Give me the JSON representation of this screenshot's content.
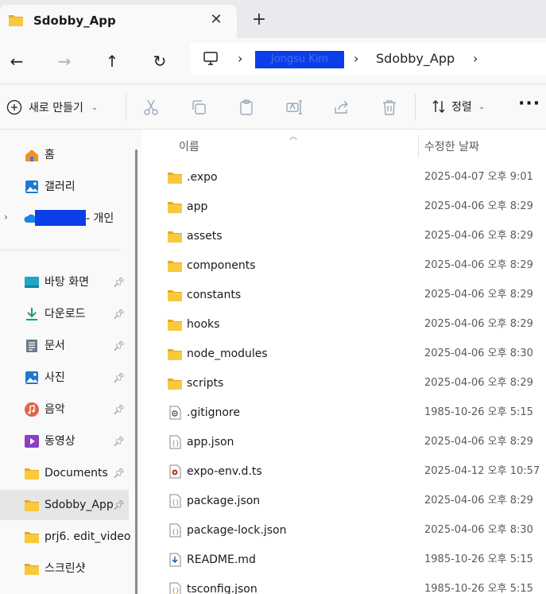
{
  "tab": {
    "title": "Sdobby_App",
    "close": "✕",
    "new": "+"
  },
  "nav": {
    "back": "←",
    "forward": "→",
    "up": "↑",
    "refresh": "↻",
    "breadcrumbs": [
      "Jongsu Kim",
      "Sdobby_App"
    ],
    "sep": "›"
  },
  "toolbar": {
    "new_label": "새로 만들기",
    "sort_label": "정렬",
    "more": "···"
  },
  "sidebar": {
    "items": [
      {
        "label": "홈",
        "icon": "home-icon"
      },
      {
        "label": "갤러리",
        "icon": "gallery-icon"
      },
      {
        "label": "- 개인",
        "icon": "onedrive-icon"
      },
      {
        "label": "바탕 화면",
        "icon": "desktop-icon"
      },
      {
        "label": "다운로드",
        "icon": "download-icon"
      },
      {
        "label": "문서",
        "icon": "document-icon"
      },
      {
        "label": "사진",
        "icon": "pictures-icon"
      },
      {
        "label": "음악",
        "icon": "music-icon"
      },
      {
        "label": "동영상",
        "icon": "video-icon"
      },
      {
        "label": "Documents",
        "icon": "folder-icon"
      },
      {
        "label": "Sdobby_App",
        "icon": "folder-icon"
      },
      {
        "label": "prj6. edit_video",
        "icon": "folder-icon"
      },
      {
        "label": "스크린샷",
        "icon": "folder-icon"
      }
    ]
  },
  "filelist": {
    "columns": {
      "name": "이름",
      "date": "수정한 날짜"
    },
    "rows": [
      {
        "name": ".expo",
        "date": "2025-04-07 오후 9:01",
        "type": "folder"
      },
      {
        "name": "app",
        "date": "2025-04-06 오후 8:29",
        "type": "folder"
      },
      {
        "name": "assets",
        "date": "2025-04-06 오후 8:29",
        "type": "folder"
      },
      {
        "name": "components",
        "date": "2025-04-06 오후 8:29",
        "type": "folder"
      },
      {
        "name": "constants",
        "date": "2025-04-06 오후 8:29",
        "type": "folder"
      },
      {
        "name": "hooks",
        "date": "2025-04-06 오후 8:29",
        "type": "folder"
      },
      {
        "name": "node_modules",
        "date": "2025-04-06 오후 8:30",
        "type": "folder"
      },
      {
        "name": "scripts",
        "date": "2025-04-06 오후 8:29",
        "type": "folder"
      },
      {
        "name": ".gitignore",
        "date": "1985-10-26 오후 5:15",
        "type": "config"
      },
      {
        "name": "app.json",
        "date": "2025-04-06 오후 8:29",
        "type": "json"
      },
      {
        "name": "expo-env.d.ts",
        "date": "2025-04-12 오후 10:57",
        "type": "ts"
      },
      {
        "name": "package.json",
        "date": "2025-04-06 오후 8:29",
        "type": "json"
      },
      {
        "name": "package-lock.json",
        "date": "2025-04-06 오후 8:30",
        "type": "json"
      },
      {
        "name": "README.md",
        "date": "1985-10-26 오후 5:15",
        "type": "md"
      },
      {
        "name": "tsconfig.json",
        "date": "1985-10-26 오후 5:15",
        "type": "json"
      }
    ]
  },
  "colors": {
    "folder": "#f8c93e",
    "folder_dark": "#e8a823",
    "accent": "#0a3ee8",
    "selected": "#e6e6e6"
  }
}
